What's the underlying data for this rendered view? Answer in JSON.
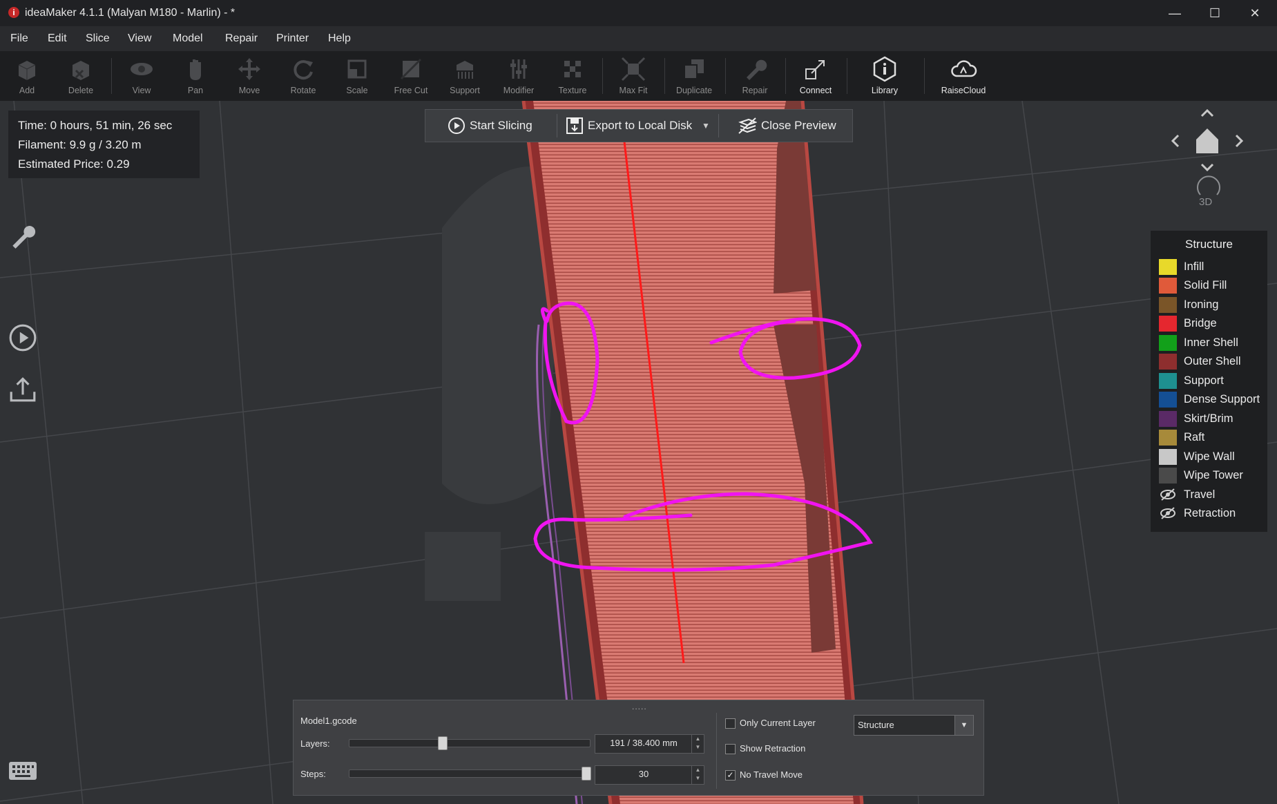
{
  "window": {
    "title": "ideaMaker 4.1.1 (Malyan M180 - Marlin) - *",
    "icon_letter": "i",
    "minimize": "—",
    "maximize": "☐",
    "close": "✕"
  },
  "menu": [
    "File",
    "Edit",
    "Slice",
    "View",
    "Model",
    "Repair",
    "Printer",
    "Help"
  ],
  "toolbar": {
    "add": "Add",
    "delete": "Delete",
    "view": "View",
    "pan": "Pan",
    "move": "Move",
    "rotate": "Rotate",
    "scale": "Scale",
    "free_cut": "Free Cut",
    "support": "Support",
    "modifier": "Modifier",
    "texture": "Texture",
    "max_fit": "Max Fit",
    "duplicate": "Duplicate",
    "repair": "Repair",
    "connect": "Connect",
    "library": "Library",
    "raisecloud": "RaiseCloud"
  },
  "stats": {
    "time": "Time: 0 hours, 51 min, 26 sec",
    "filament": "Filament: 9.9 g / 3.20 m",
    "price": "Estimated Price: 0.29"
  },
  "actions": {
    "start_slicing": "Start Slicing",
    "export": "Export to Local Disk",
    "close_preview": "Close Preview"
  },
  "nav": {
    "view3d": "3D"
  },
  "legend": {
    "title": "Structure",
    "items": [
      {
        "label": "Infill",
        "color": "#e8d92a"
      },
      {
        "label": "Solid Fill",
        "color": "#e05a3a"
      },
      {
        "label": "Ironing",
        "color": "#7a5528"
      },
      {
        "label": "Bridge",
        "color": "#e5272f"
      },
      {
        "label": "Inner Shell",
        "color": "#12a01a"
      },
      {
        "label": "Outer Shell",
        "color": "#8e2e2e"
      },
      {
        "label": "Support",
        "color": "#1e9090"
      },
      {
        "label": "Dense Support",
        "color": "#144f94"
      },
      {
        "label": "Skirt/Brim",
        "color": "#5a2a66"
      },
      {
        "label": "Raft",
        "color": "#a78a3a"
      },
      {
        "label": "Wipe Wall",
        "color": "#c8c8c8"
      },
      {
        "label": "Wipe Tower",
        "color": "#4a4a4a"
      },
      {
        "label": "Travel",
        "color": "",
        "icon": "eye-hidden-icon"
      },
      {
        "label": "Retraction",
        "color": "",
        "icon": "eye-hidden-icon"
      }
    ]
  },
  "panel": {
    "file": "Model1.gcode",
    "layers_label": "Layers:",
    "layers_value": "191 / 38.400 mm",
    "steps_label": "Steps:",
    "steps_value": "30",
    "only_current_layer": "Only Current Layer",
    "show_retraction": "Show Retraction",
    "no_travel_move": "No Travel Move",
    "view_mode": "Structure",
    "grip": "....."
  },
  "slider_values": {
    "layers_fraction": 0.38,
    "steps_fraction": 1.0
  }
}
